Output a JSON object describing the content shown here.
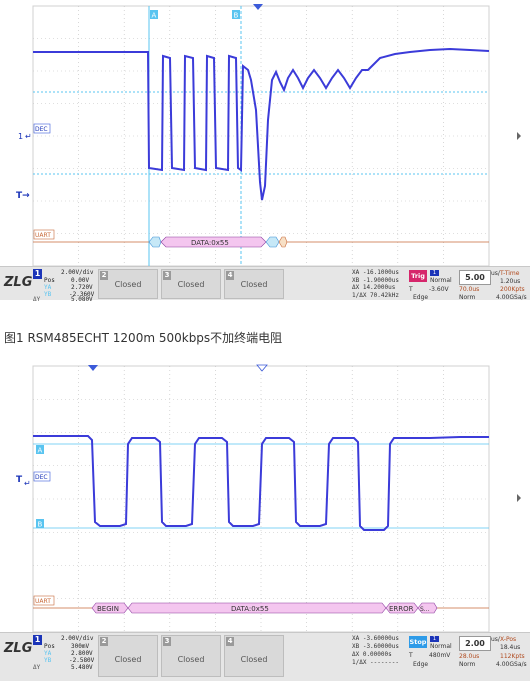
{
  "caption": "图1 RSM485ECHT 1200m 500kbps不加终端电阻",
  "colors": {
    "trace": "#3b3bd9",
    "cursor_line": "#59c4f0",
    "grid_dot": "#bfbfbf",
    "decode_fill": "#f4c6ef",
    "uart_line": "#c86a3a"
  },
  "icons": {
    "ch_ground": "arrow-right-icon",
    "trigger": "trigger-arrow-icon",
    "scroll": "scroll-right-icon"
  },
  "scope1": {
    "markers": {
      "cursor_a": "A",
      "cursor_b": "B"
    },
    "ch_label": "1",
    "dec_tag": "DEC",
    "trig_tag": "T",
    "uart_tag": "UART",
    "decode": {
      "data_label": "DATA:0x55"
    },
    "status": {
      "logo": "ZLG",
      "ch1": {
        "num": "1",
        "scale": "2.00V/div",
        "pos_label": "Pos",
        "pos_val": "0.00V",
        "ya_label": "YA",
        "ya_val": "2.720V",
        "yb_label": "YB",
        "yb_val": "-2.360V",
        "dy_label": "ΔY",
        "dy_val": "5.080V"
      },
      "channels": [
        {
          "num": "2",
          "label": "Closed"
        },
        {
          "num": "3",
          "label": "Closed"
        },
        {
          "num": "4",
          "label": "Closed"
        }
      ],
      "cursor": {
        "xa": "XA  -16.1000us",
        "xb": "XB  -1.90000us",
        "dx": "ΔX   14.2000us",
        "inv": "1/ΔX  70.42kHz"
      },
      "trig": {
        "btn": "Trig",
        "mode": "Normal",
        "t": "T",
        "level": "-3.60V",
        "type": "Edge"
      },
      "timebase": {
        "main": "5.00",
        "unit": "us/",
        "delay": "70.0us",
        "norm": "Norm"
      },
      "right": {
        "title": "T-Time",
        "val1": "1.20us",
        "rate": "200Kpts",
        "srate": "4.00GSa/s"
      }
    }
  },
  "scope2": {
    "markers": {
      "cursor_a": "A",
      "cursor_b": "B"
    },
    "dec_tag": "DEC",
    "trig_tag": "T",
    "uart_tag": "UART",
    "decode": {
      "begin": "BEGIN",
      "data_label": "DATA:0x55",
      "error": "ERROR",
      "tail": "S..."
    },
    "status": {
      "logo": "ZLG",
      "ch1": {
        "num": "1",
        "scale": "2.00V/div",
        "pos_label": "Pos",
        "pos_val": "300mV",
        "ya_label": "YA",
        "ya_val": "2.800V",
        "yb_label": "YB",
        "yb_val": "-2.580V",
        "dy_label": "ΔY",
        "dy_val": "5.480V"
      },
      "channels": [
        {
          "num": "2",
          "label": "Closed"
        },
        {
          "num": "3",
          "label": "Closed"
        },
        {
          "num": "4",
          "label": "Closed"
        }
      ],
      "cursor": {
        "xa": "XA  -3.60000us",
        "xb": "XB  -3.60000us",
        "dx": "ΔX   0.00000s",
        "inv": "1/ΔX  --------"
      },
      "trig": {
        "btn": "Stop",
        "mode": "Normal",
        "t": "T",
        "level": "480mV",
        "type": "Edge"
      },
      "timebase": {
        "main": "2.00",
        "unit": "us/",
        "delay": "28.0us",
        "norm": "Norm"
      },
      "right": {
        "title": "X-Pos",
        "val1": "18.4us",
        "rate": "112Kpts",
        "srate": "4.00GSa/s"
      }
    }
  }
}
